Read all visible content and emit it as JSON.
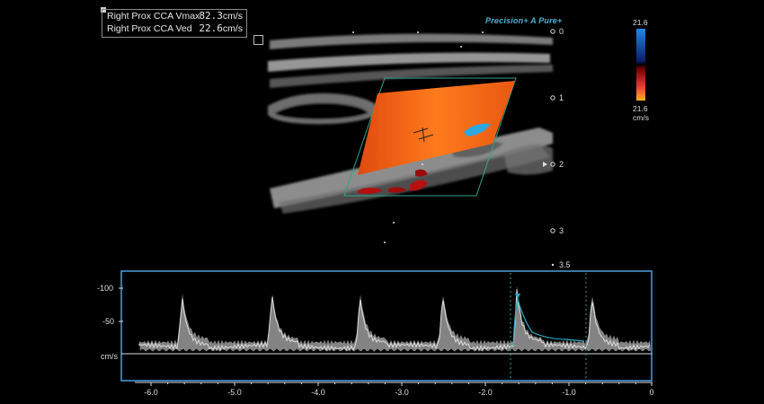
{
  "measurements": [
    {
      "label": "Right Prox CCA Vmax",
      "value": "82.3",
      "unit": "cm/s"
    },
    {
      "label": "Right Prox CCA Ved",
      "value": "22.6",
      "unit": "cm/s"
    }
  ],
  "brand": {
    "text": "Precision+ A Pure+"
  },
  "depth_scale": {
    "labels": [
      "0",
      "1",
      "2",
      "3",
      "3.5"
    ]
  },
  "color_scale": {
    "top_value": "21.6",
    "bottom_value": "21.6",
    "unit": "cm/s",
    "positive_color": "#1e88e5",
    "negative_color": "#e53935"
  },
  "doppler": {
    "y_ticks": [
      "-100",
      "-50"
    ],
    "y_unit": "cm/s",
    "x_ticks": [
      "-6.0",
      "-5.0",
      "-4.0",
      "-3.0",
      "-2.0",
      "-1.0",
      "0"
    ],
    "accent_color": "#4a9fe0"
  }
}
